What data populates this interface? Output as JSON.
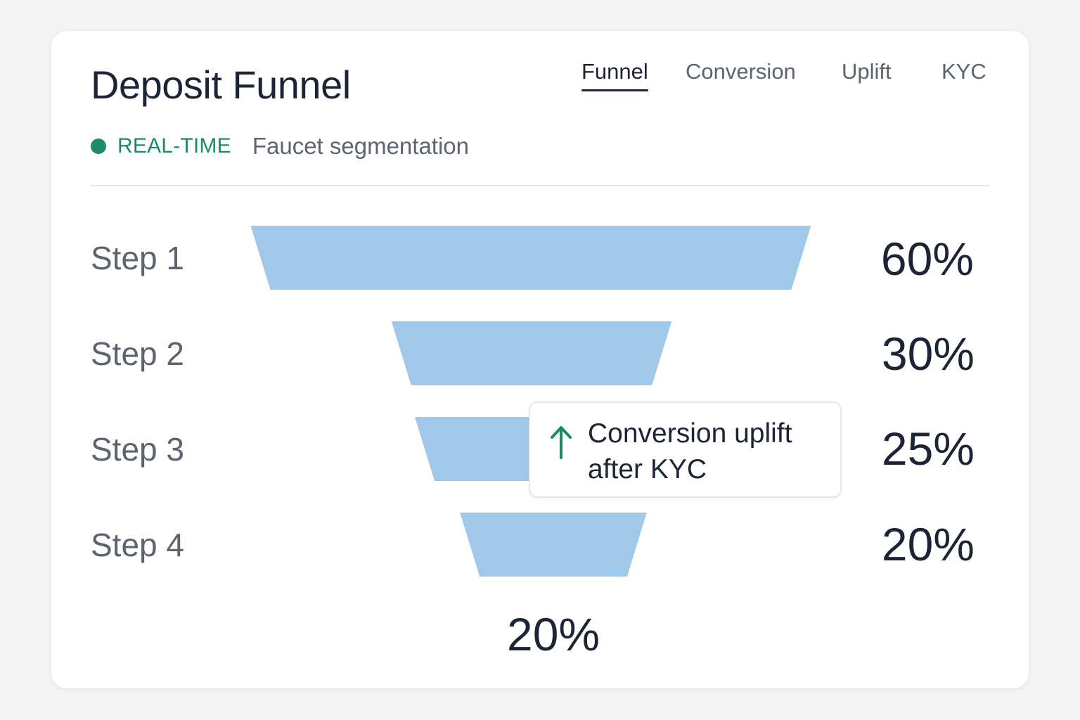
{
  "header": {
    "title": "Deposit Funnel",
    "tabs": [
      {
        "label": "Funnel",
        "active": true
      },
      {
        "label": "Conversion",
        "active": false
      },
      {
        "label": "Uplift",
        "active": false
      },
      {
        "label": "KYC",
        "active": false
      }
    ],
    "status_label": "REAL-TIME",
    "segment_label": "Faucet segmentation"
  },
  "callout": {
    "icon": "arrow-up-icon",
    "line1": "Conversion uplift",
    "line2": "after KYC"
  },
  "colors": {
    "bar": "#9fc8e9",
    "accent_green": "#1b8a6b",
    "text_dark": "#1c2535",
    "text_muted": "#5d6470"
  },
  "chart_data": {
    "type": "bar",
    "subtype": "funnel",
    "categories": [
      "Step 1",
      "Step 2",
      "Step 3",
      "Step 4"
    ],
    "values": [
      60,
      30,
      25,
      20
    ],
    "value_labels": [
      "60%",
      "30%",
      "25%",
      "20%"
    ],
    "final_label": "20%",
    "title": "Deposit Funnel",
    "xlabel": "",
    "ylabel": "",
    "grid": false,
    "legend": "none"
  }
}
